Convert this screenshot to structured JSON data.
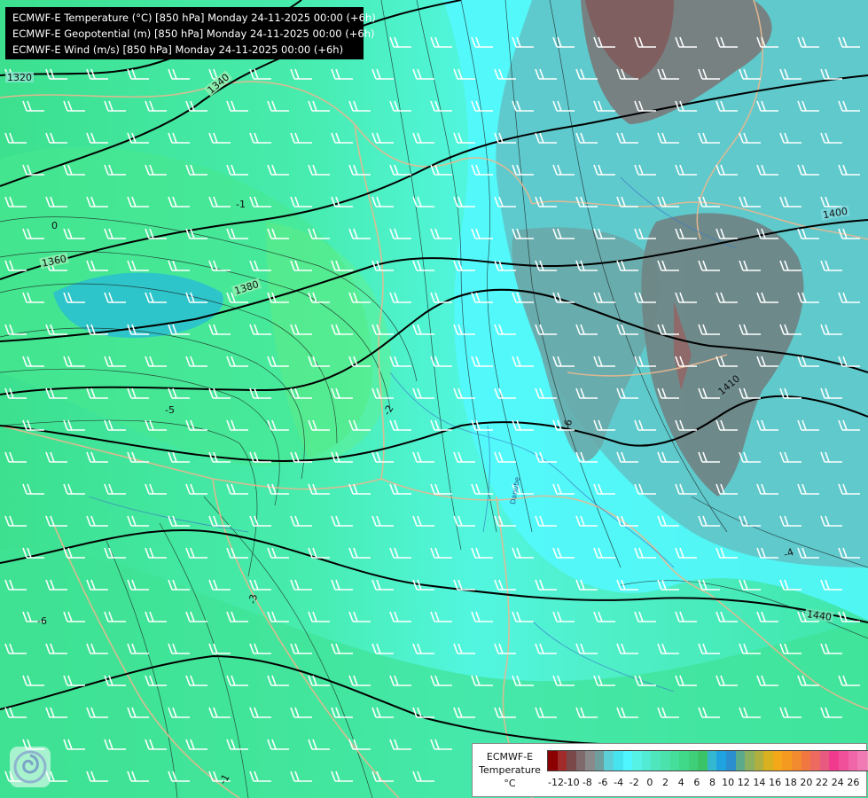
{
  "header": {
    "lines": [
      "ECMWF-E Temperature (°C) [850 hPa] Monday 24-11-2025 00:00 (+6h)",
      "ECMWF-E Geopotential (m) [850 hPa] Monday 24-11-2025 00:00 (+6h)",
      "ECMWF-E Wind (m/s) [850 hPa] Monday 24-11-2025 00:00 (+6h)"
    ]
  },
  "legend": {
    "title_line1": "ECMWF-E",
    "title_line2": "Temperature",
    "unit": "°C",
    "colors": [
      "#8b0000",
      "#a12b2b",
      "#7a4848",
      "#7e6a6a",
      "#8a8a8a",
      "#6e9e9e",
      "#5dcfd6",
      "#45e4ef",
      "#4ff6ff",
      "#57f2e6",
      "#52ead2",
      "#4fe6be",
      "#4be2ad",
      "#45de9b",
      "#40d98a",
      "#3ecf78",
      "#3ac467",
      "#34b8d0",
      "#1fa3e0",
      "#2a8ecf",
      "#5caa8c",
      "#8ab060",
      "#b0b040",
      "#d8b020",
      "#f2a818",
      "#f59a20",
      "#f28a30",
      "#f07840",
      "#ec6a60",
      "#e85a80",
      "#f03a8e",
      "#f0509a",
      "#f066a8",
      "#f07ab4",
      "#f08ec0",
      "#f0a0b0",
      "#f09090",
      "#f07a70",
      "#f06850",
      "#f05a3a",
      "#f04828",
      "#ee3418",
      "#e82410"
    ],
    "ticks": [
      "-12",
      "-10",
      "-8",
      "-6",
      "-4",
      "-2",
      "0",
      "2",
      "4",
      "6",
      "8",
      "10",
      "12",
      "14",
      "16",
      "18",
      "20",
      "22",
      "24",
      "26"
    ]
  },
  "map": {
    "height_labels": [
      "1320",
      "1340",
      "1360",
      "1380",
      "1400",
      "1410",
      "1440"
    ],
    "temperature_labels": [
      "0",
      "-1",
      "-5",
      "-2",
      "-3",
      "-6",
      "-4",
      "-1",
      "-6"
    ],
    "river_label": "Danube"
  }
}
